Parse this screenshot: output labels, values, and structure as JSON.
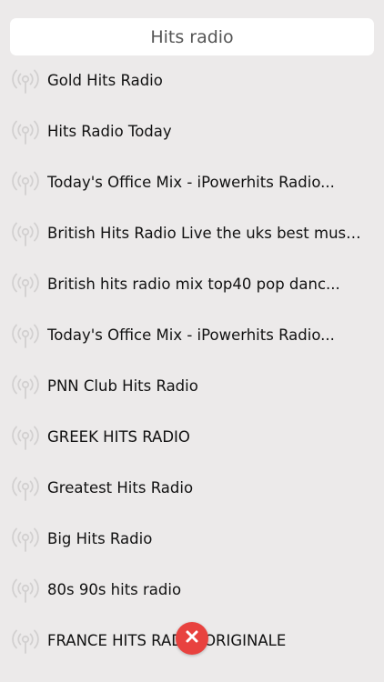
{
  "search": {
    "title": "Hits radio"
  },
  "stations": [
    {
      "label": "Gold Hits Radio",
      "icon": "radio-broadcast-icon"
    },
    {
      "label": "Hits Radio Today",
      "icon": "radio-broadcast-icon"
    },
    {
      "label": "Today's Office Mix - iPowerhits Radio...",
      "icon": "radio-broadcast-icon"
    },
    {
      "label": "British Hits Radio Live  the uks best musi...",
      "icon": "radio-broadcast-icon"
    },
    {
      "label": "British hits radio mix top40 pop danc...",
      "icon": "radio-broadcast-icon"
    },
    {
      "label": "Today's Office Mix - iPowerhits Radio...",
      "icon": "radio-broadcast-icon"
    },
    {
      "label": "PNN Club Hits Radio",
      "icon": "radio-broadcast-icon"
    },
    {
      "label": "GREEK HITS RADIO",
      "icon": "radio-broadcast-icon"
    },
    {
      "label": "Greatest Hits Radio",
      "icon": "radio-broadcast-icon"
    },
    {
      "label": "Big Hits Radio",
      "icon": "radio-broadcast-icon"
    },
    {
      "label": "80s 90s hits radio",
      "icon": "radio-broadcast-icon"
    },
    {
      "label": "FRANCE HITS RADIO ORIGINALE",
      "icon": "radio-broadcast-icon"
    }
  ],
  "close": {
    "icon": "close-icon",
    "color": "#e8423f"
  },
  "colors": {
    "background": "#eceaea",
    "icon": "#d2d0d0",
    "text": "#111111"
  }
}
